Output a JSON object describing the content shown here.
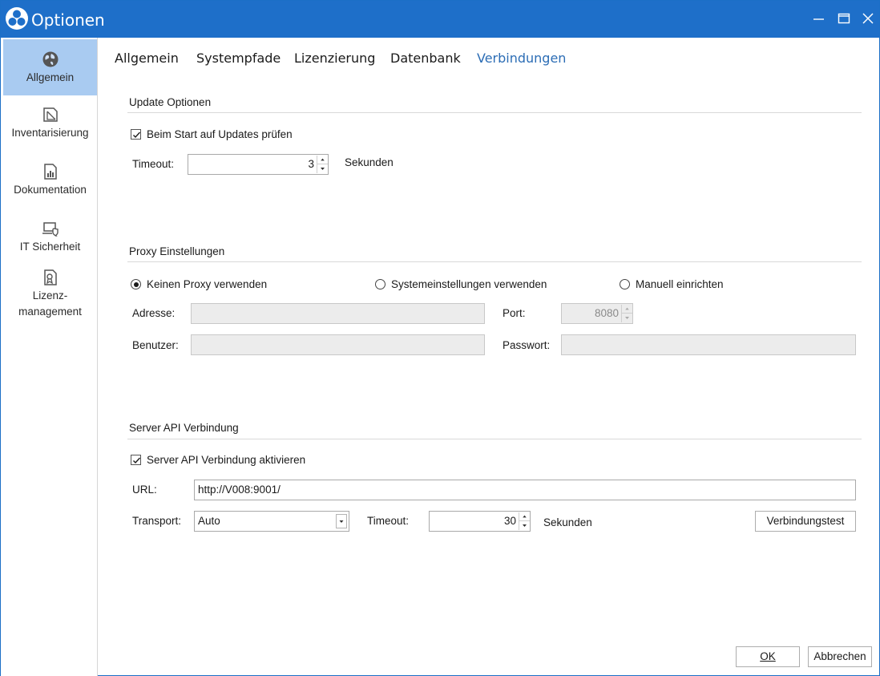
{
  "window": {
    "title": "Optionen"
  },
  "sidebar": {
    "items": [
      {
        "label": "Allgemein",
        "icon": "globe-icon"
      },
      {
        "label": "Inventarisierung",
        "icon": "document-folded-icon"
      },
      {
        "label": "Dokumentation",
        "icon": "report-chart-icon"
      },
      {
        "label": "IT Sicherheit",
        "icon": "laptop-shield-icon"
      },
      {
        "label_line1": "Lizenz-",
        "label_line2": "management",
        "icon": "certificate-icon"
      }
    ]
  },
  "tabs": [
    "Allgemein",
    "Systempfade",
    "Lizenzierung",
    "Datenbank",
    "Verbindungen"
  ],
  "update": {
    "title": "Update Optionen",
    "check_label": "Beim Start auf Updates prüfen",
    "check_checked": true,
    "timeout_label": "Timeout:",
    "timeout_value": "3",
    "timeout_unit": "Sekunden"
  },
  "proxy": {
    "title": "Proxy Einstellungen",
    "options": [
      "Keinen Proxy verwenden",
      "Systemeinstellungen verwenden",
      "Manuell einrichten"
    ],
    "selected": "Keinen Proxy verwenden",
    "address_label": "Adresse:",
    "address_value": "",
    "port_label": "Port:",
    "port_value": "8080",
    "user_label": "Benutzer:",
    "user_value": "",
    "password_label": "Passwort:",
    "password_value": ""
  },
  "server_api": {
    "title": "Server API Verbindung",
    "enable_label": "Server API Verbindung aktivieren",
    "enable_checked": true,
    "url_label": "URL:",
    "url_value": "http://V008:9001/",
    "transport_label": "Transport:",
    "transport_value": "Auto",
    "timeout_label": "Timeout:",
    "timeout_value": "30",
    "timeout_unit": "Sekunden",
    "test_button": "Verbindungstest"
  },
  "footer": {
    "ok_button": "OK",
    "cancel_button": "Abbrechen"
  },
  "colors": {
    "titlebar": "#1e6fc9",
    "active_tab": "#2c6db5",
    "sidebar_active": "#a9cbf1"
  }
}
